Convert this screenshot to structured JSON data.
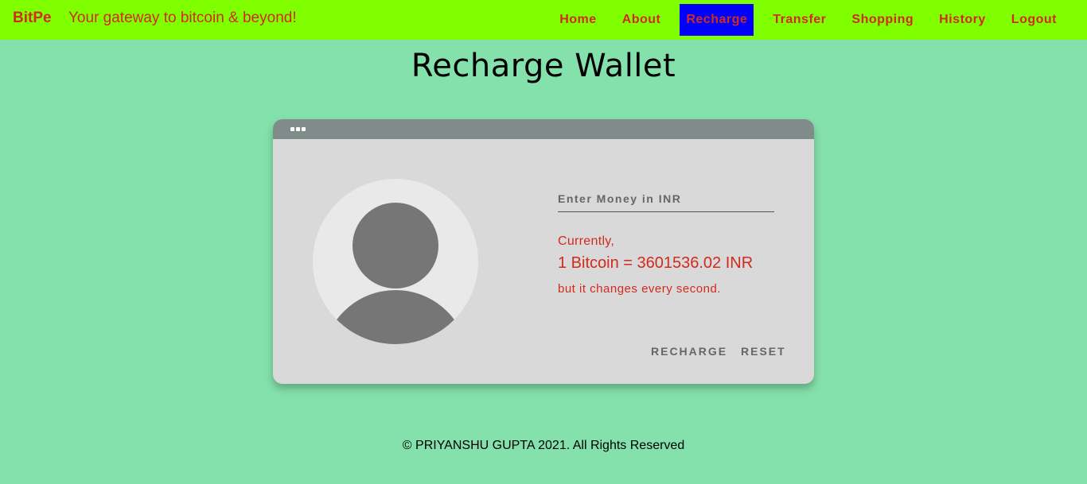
{
  "navbar": {
    "brand": "BitPe",
    "tagline": "Your gateway to bitcoin & beyond!",
    "links": [
      {
        "label": "Home"
      },
      {
        "label": "About"
      },
      {
        "label": "Recharge",
        "active": true
      },
      {
        "label": "Transfer"
      },
      {
        "label": "Shopping"
      },
      {
        "label": "History"
      },
      {
        "label": "Logout"
      }
    ],
    "colors": {
      "background": "#7fff00",
      "text": "#d22a1d",
      "active_bg": "#0000ff"
    }
  },
  "page": {
    "title": "Recharge Wallet",
    "background": "#84e1ab"
  },
  "card": {
    "avatar_icon": "user-avatar-icon",
    "input_placeholder": "Enter Money in INR",
    "input_value": "",
    "rate_prefix": "Currently,",
    "rate_text": "1 Bitcoin = 3601536.02 INR",
    "rate_note": "but it changes every second.",
    "recharge_button": "RECHARGE",
    "reset_button": "RESET"
  },
  "footer": {
    "text": "© PRIYANSHU GUPTA 2021. All Rights Reserved"
  }
}
